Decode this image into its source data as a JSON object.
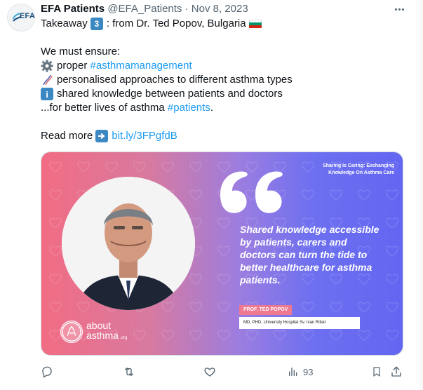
{
  "author": {
    "avatar_text": "EFA",
    "display_name": "EFA Patients",
    "handle": "@EFA_Patients",
    "separator": "·",
    "date": "Nov 8, 2023"
  },
  "tweet": {
    "line1_prefix": "Takeaway",
    "line1_keycap": "3",
    "line1_suffix": ": from Dr. Ted Popov, Bulgaria",
    "intro": "We must ensure:",
    "item1_text": "proper",
    "item1_hashtag": "#asthmamanagement",
    "item2_text": "personalised approaches to different asthma types",
    "item3_icon": "i",
    "item3_text": "shared knowledge between patients and doctors",
    "line_end_text": "...for better lives of asthma",
    "line_end_hashtag": "#patients",
    "line_end_period": ".",
    "read_more": "Read more",
    "link": "bit.ly/3FPgfdB"
  },
  "media": {
    "tag_line1": "Sharing Is Caring: Exchanging",
    "tag_line2": "Knowledge On Asthma Care",
    "quote": "Shared knowledge accessible by patients, carers and doctors can turn the tide to better healthcare for asthma patients.",
    "speaker": "PROF. TED POPOV",
    "speaker_title": "MD, PHD, University Hospital Sv. Ivan Rilski",
    "brand_line1": "about",
    "brand_line2": "asthma",
    "brand_suffix": ".org"
  },
  "actions": {
    "views_count": "93"
  },
  "icons": {
    "more": "more-icon",
    "reply": "reply-icon",
    "retweet": "retweet-icon",
    "like": "like-icon",
    "views": "views-icon",
    "bookmark": "bookmark-icon",
    "share": "share-icon",
    "gear": "gear-icon",
    "dna": "dna-icon",
    "info": "info-icon",
    "arrow": "arrow-right-icon",
    "keycap": "keycap-3-icon",
    "flag": "bulgaria-flag-icon"
  },
  "colors": {
    "link": "#1d9bf0",
    "muted": "#536471",
    "card_pink": "#f26c84",
    "card_indigo": "#6366f1",
    "emoji_blue": "#3b88c3"
  }
}
